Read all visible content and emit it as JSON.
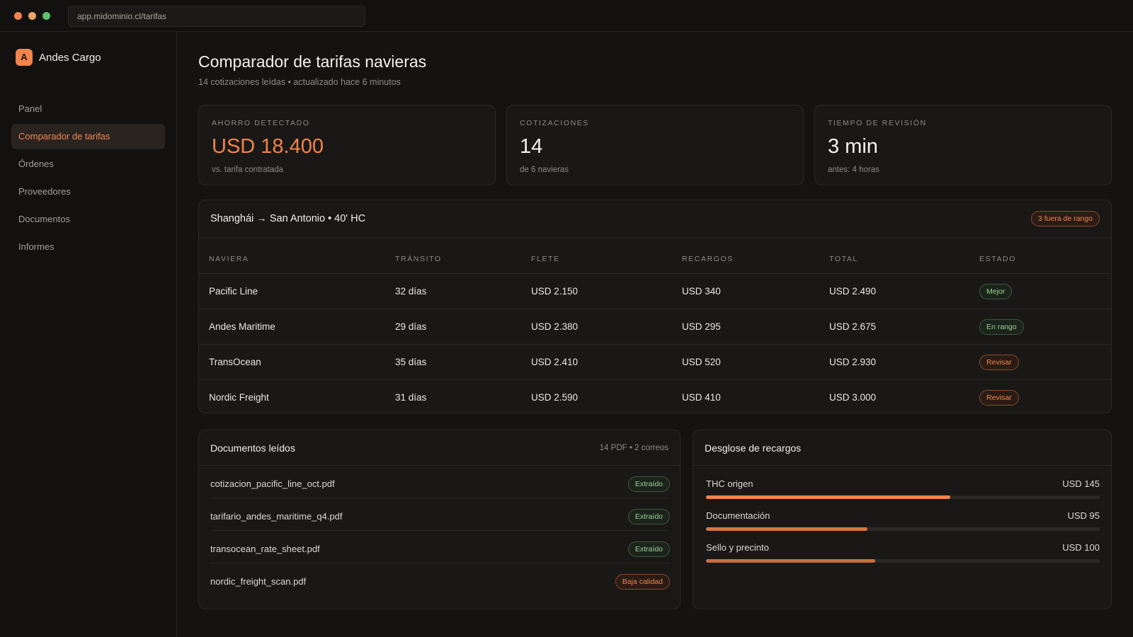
{
  "browser": {
    "url": "app.midominio.cl/tarifas"
  },
  "sidebar": {
    "brand_initial": "A",
    "brand_name": "Andes Cargo",
    "items": [
      {
        "label": "Panel",
        "active": false
      },
      {
        "label": "Comparador de tarifas",
        "active": true
      },
      {
        "label": "Órdenes",
        "active": false
      },
      {
        "label": "Proveedores",
        "active": false
      },
      {
        "label": "Documentos",
        "active": false
      },
      {
        "label": "Informes",
        "active": false
      }
    ]
  },
  "header": {
    "title": "Comparador de tarifas navieras",
    "subtitle": "14 cotizaciones leídas • actualizado hace 6 minutos"
  },
  "stats": [
    {
      "label": "AHORRO DETECTADO",
      "value": "USD 18.400",
      "note": "vs. tarifa contratada"
    },
    {
      "label": "COTIZACIONES",
      "value": "14",
      "note": "de 6 navieras"
    },
    {
      "label": "TIEMPO DE REVISIÓN",
      "value": "3 min",
      "note": "antes: 4 horas"
    }
  ],
  "route": {
    "title": "Shanghái → San Antonio • 40' HC",
    "badge": "3 fuera de rango",
    "columns": [
      "NAVIERA",
      "TRÁNSITO",
      "FLETE",
      "RECARGOS",
      "TOTAL",
      "ESTADO"
    ],
    "rows": [
      {
        "carrier": "Pacific Line",
        "transit": "32 días",
        "freight": "USD 2.150",
        "surcharges": "USD 340",
        "total": "USD 2.490",
        "status": "Mejor",
        "status_tone": "green"
      },
      {
        "carrier": "Andes Maritime",
        "transit": "29 días",
        "freight": "USD 2.380",
        "surcharges": "USD 295",
        "total": "USD 2.675",
        "status": "En rango",
        "status_tone": "green"
      },
      {
        "carrier": "TransOcean",
        "transit": "35 días",
        "freight": "USD 2.410",
        "surcharges": "USD 520",
        "total": "USD 2.930",
        "status": "Revisar",
        "status_tone": "orange"
      },
      {
        "carrier": "Nordic Freight",
        "transit": "31 días",
        "freight": "USD 2.590",
        "surcharges": "USD 410",
        "total": "USD 3.000",
        "status": "Revisar",
        "status_tone": "orange"
      }
    ]
  },
  "documents": {
    "title": "Documentos leídos",
    "meta": "14 PDF • 2 correos",
    "items": [
      {
        "name": "cotizacion_pacific_line_oct.pdf",
        "status": "Extraído"
      },
      {
        "name": "tarifario_andes_maritime_q4.pdf",
        "status": "Extraído"
      },
      {
        "name": "transocean_rate_sheet.pdf",
        "status": "Extraído"
      },
      {
        "name": "nordic_freight_scan.pdf",
        "status": "Baja calidad"
      }
    ]
  },
  "surcharges": {
    "title": "Desglose de recargos",
    "items": [
      {
        "label": "THC origen",
        "value": "USD 145",
        "fraction": 0.62,
        "color": "#f2844c"
      },
      {
        "label": "Documentación",
        "value": "USD 95",
        "fraction": 0.41,
        "color": "#d9763f"
      },
      {
        "label": "Sello y precinto",
        "value": "USD 100",
        "fraction": 0.43,
        "color": "#c86e3d"
      }
    ]
  },
  "colors": {
    "accent": "#f2844c",
    "background": "#151311",
    "panel": "#1a1816",
    "success": "#9fd29a"
  }
}
